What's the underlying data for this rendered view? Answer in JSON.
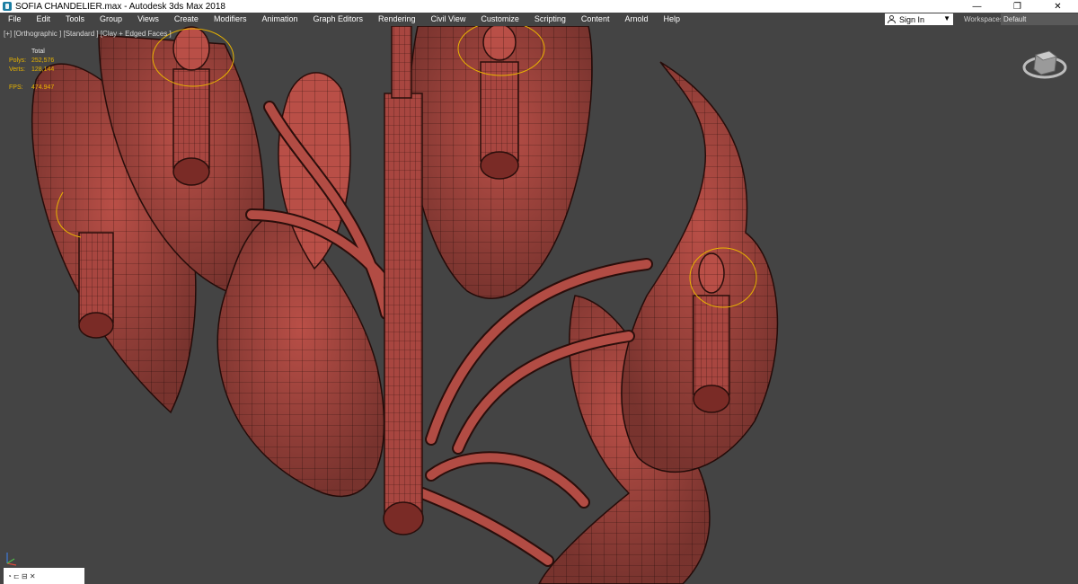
{
  "window": {
    "title": "SOFIA CHANDELIER.max - Autodesk 3ds Max 2018",
    "controls": {
      "minimize": "—",
      "restore": "❐",
      "close": "✕"
    }
  },
  "menu": {
    "items": [
      "File",
      "Edit",
      "Tools",
      "Group",
      "Views",
      "Create",
      "Modifiers",
      "Animation",
      "Graph Editors",
      "Rendering",
      "Civil View",
      "Customize",
      "Scripting",
      "Content",
      "Arnold",
      "Help"
    ],
    "sign_in": "Sign In",
    "workspaces_label": "Workspaces:",
    "workspace_value": "Default"
  },
  "viewport": {
    "label": "[+] [Orthographic ] [Standard ] [Clay + Edged Faces ]",
    "stats": {
      "header": "Total",
      "polys_label": "Polys:",
      "polys_value": "252,576",
      "verts_label": "Verts:",
      "verts_value": "128,144",
      "fps_label": "FPS:",
      "fps_value": "474.947"
    }
  },
  "colors": {
    "viewport_bg": "#444444",
    "clay": "#b94f47",
    "wire": "#3a1410",
    "selection": "#e8b400"
  },
  "icons": [
    "app-icon",
    "user-icon",
    "viewcube-icon",
    "axis-tripod-icon"
  ],
  "statusbar": {
    "mini": "◔ ⊏  ⊟  ✕"
  }
}
